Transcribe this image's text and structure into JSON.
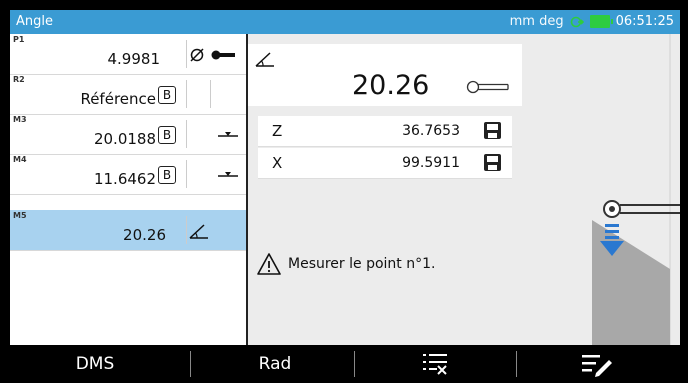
{
  "titlebar": {
    "title": "Angle",
    "units": "mm deg",
    "time": "06:51:25",
    "icons": [
      "signal-icon",
      "battery-icon"
    ]
  },
  "memory_list": [
    {
      "tag": "P1",
      "value": "4.9981",
      "badge": "",
      "symbol": "diameter-icon",
      "probe": "probe-icon"
    },
    {
      "tag": "R2",
      "value": "Référence",
      "badge": "B",
      "symbol": "",
      "probe": ""
    },
    {
      "tag": "M3",
      "value": "20.0188",
      "badge": "B",
      "symbol": "",
      "probe": "plane-icon"
    },
    {
      "tag": "M4",
      "value": "11.6462",
      "badge": "B",
      "symbol": "",
      "probe": "plane-icon"
    },
    {
      "tag": "M5",
      "value": "20.26",
      "badge": "",
      "symbol": "angle-icon",
      "probe": "",
      "selected": true
    }
  ],
  "display": {
    "main_value": "20.26",
    "main_icon": "angle-icon",
    "probe_icon": "probe-tip-icon",
    "rows": [
      {
        "axis": "Z",
        "value": "36.7653",
        "icon": "save-icon"
      },
      {
        "axis": "X",
        "value": "99.5911",
        "icon": "save-icon"
      }
    ],
    "message": "Mesurer le point n°1.",
    "message_icon": "warning-icon"
  },
  "softkeys": [
    {
      "label": "DMS"
    },
    {
      "label": "Rad"
    },
    {
      "label": "",
      "icon": "list-delete-icon"
    },
    {
      "label": "",
      "icon": "list-edit-icon"
    }
  ],
  "colors": {
    "titlebar": "#3a9bd3",
    "selected_row": "#a8d2ef",
    "graphic_gray": "#a8a8a8",
    "arrow_blue": "#2a78d0"
  }
}
